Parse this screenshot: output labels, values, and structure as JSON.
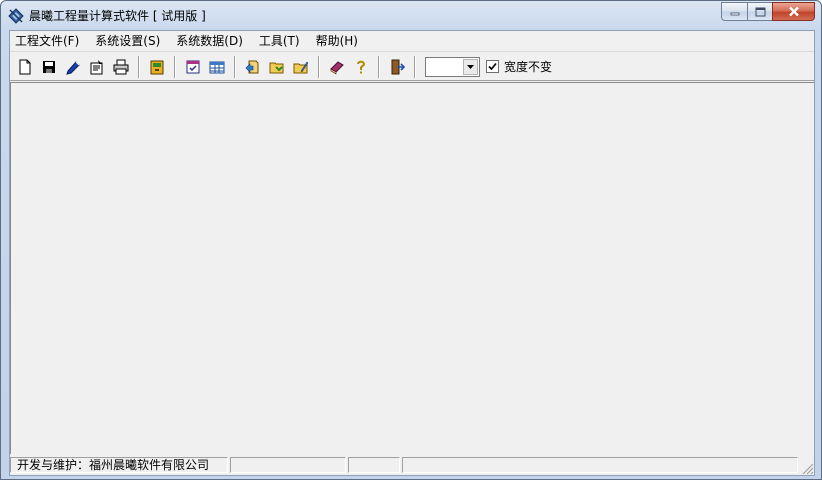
{
  "window": {
    "title": "晨曦工程量计算式软件 [ 试用版 ]"
  },
  "menu": [
    {
      "label": "工程文件(F)"
    },
    {
      "label": "系统设置(S)"
    },
    {
      "label": "系统数据(D)"
    },
    {
      "label": "工具(T)"
    },
    {
      "label": "帮助(H)"
    }
  ],
  "toolbar": {
    "buttons": [
      {
        "icon": "new-file-icon"
      },
      {
        "icon": "save-icon"
      },
      {
        "icon": "edit-pen-icon"
      },
      {
        "icon": "properties-icon"
      },
      {
        "icon": "print-icon"
      },
      {
        "icon": "export-icon"
      },
      {
        "icon": "document-check-icon"
      },
      {
        "icon": "table-icon"
      },
      {
        "icon": "import-icon"
      },
      {
        "icon": "open-folder-icon"
      },
      {
        "icon": "edit-folder-icon"
      },
      {
        "icon": "book-icon"
      },
      {
        "icon": "help-icon"
      },
      {
        "icon": "exit-icon"
      }
    ],
    "select_value": "",
    "checkbox_label": "宽度不变",
    "checkbox_checked": true
  },
  "status": {
    "panel1": "开发与维护：福州晨曦软件有限公司",
    "panel2": "",
    "panel3": "",
    "panel4": ""
  },
  "colors": {
    "title_bar": "#c9d8ec",
    "client_background": "#f0f0f0",
    "close_button": "#c1432c"
  }
}
